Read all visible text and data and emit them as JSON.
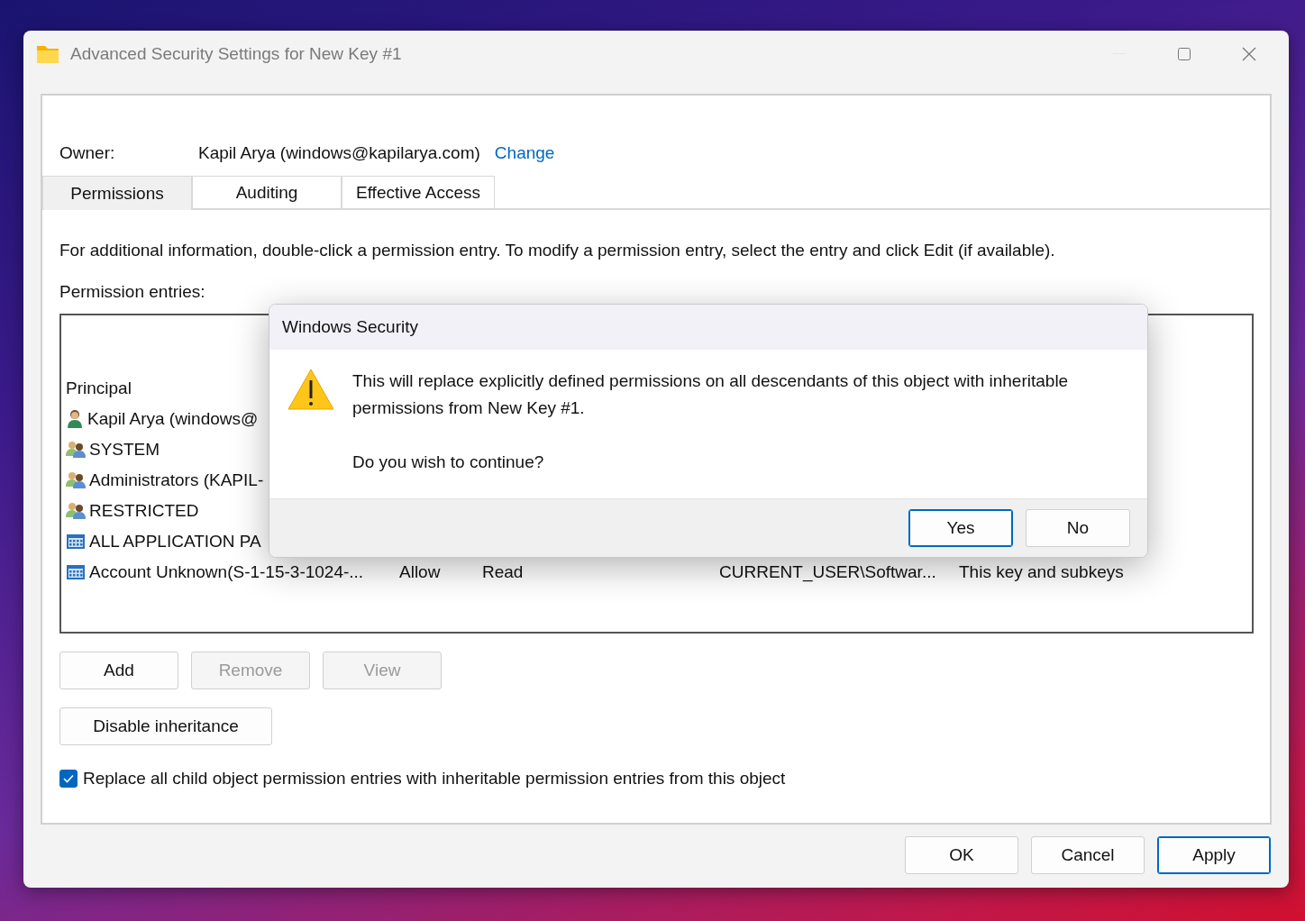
{
  "window": {
    "title": "Advanced Security Settings for New Key #1"
  },
  "owner": {
    "label": "Owner:",
    "value": "Kapil Arya (windows@kapilarya.com)",
    "link": "Change"
  },
  "tabs": [
    {
      "label": "Permissions",
      "selected": true
    },
    {
      "label": "Auditing",
      "selected": false
    },
    {
      "label": "Effective Access",
      "selected": false
    }
  ],
  "info": "For additional information, double-click a permission entry. To modify a permission entry, select the entry and click Edit (if available).",
  "entries_label": "Permission entries:",
  "table": {
    "columns": [
      "Principal"
    ],
    "rows": [
      {
        "kind": "user",
        "cells": [
          "Kapil Arya (windows@"
        ]
      },
      {
        "kind": "group",
        "cells": [
          "SYSTEM"
        ]
      },
      {
        "kind": "group",
        "cells": [
          "Administrators (KAPIL-"
        ]
      },
      {
        "kind": "group",
        "cells": [
          "RESTRICTED"
        ]
      },
      {
        "kind": "package",
        "cells": [
          "ALL APPLICATION PA"
        ]
      },
      {
        "kind": "package",
        "cells": [
          "Account Unknown(S-1-15-3-1024-...",
          "Allow",
          "Read",
          "CURRENT_USER\\Softwar...",
          "This key and subkeys"
        ]
      }
    ]
  },
  "entry_buttons": [
    {
      "label": "Add",
      "disabled": false
    },
    {
      "label": "Remove",
      "disabled": true
    },
    {
      "label": "View",
      "disabled": true
    }
  ],
  "inheritance_button": "Disable inheritance",
  "replace_checkbox": {
    "label": "Replace all child object permission entries with inheritable permission entries from this object",
    "checked": true
  },
  "footer_buttons": [
    {
      "label": "OK",
      "default": false
    },
    {
      "label": "Cancel",
      "default": false
    },
    {
      "label": "Apply",
      "default": true
    }
  ],
  "dialog": {
    "title": "Windows Security",
    "message": "This will replace explicitly defined permissions on all descendants of this object with inheritable permissions from New Key #1.",
    "question": "Do you wish to continue?",
    "buttons": [
      {
        "label": "Yes",
        "default": true
      },
      {
        "label": "No",
        "default": false
      }
    ]
  }
}
